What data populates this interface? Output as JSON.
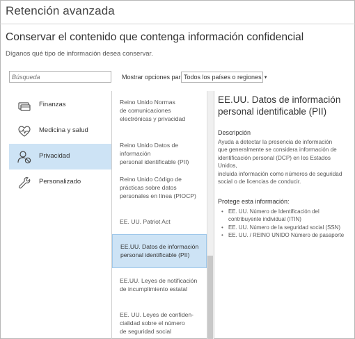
{
  "window": {
    "title": "Retención avanzada"
  },
  "page": {
    "heading": "Conservar el contenido que contenga información confidencial",
    "subheading": "Díganos qué tipo de información desea conservar."
  },
  "search": {
    "placeholder": "Búsqueda"
  },
  "filter": {
    "label": "Mostrar opciones para",
    "selected": "Todos los países o regiones"
  },
  "categories": [
    {
      "label": "Finanzas",
      "icon": "card-icon",
      "selected": false
    },
    {
      "label": "Medicina y salud",
      "icon": "heart-pulse-icon",
      "selected": false
    },
    {
      "label": "Privacidad",
      "icon": "user-block-icon",
      "selected": true
    },
    {
      "label": "Personalizado",
      "icon": "wrench-icon",
      "selected": false
    }
  ],
  "templates": [
    {
      "lines": [
        "Reino Unido Normas",
        "de comunicaciones",
        "electrónicas y privacidad"
      ],
      "selected": false
    },
    {
      "lines": [
        "Reino Unido Datos de información",
        "personal identificable (PII)"
      ],
      "selected": false
    },
    {
      "lines": [
        "Reino Unido Código de",
        "prácticas sobre datos",
        "personales en línea (PIOCP)"
      ],
      "selected": false
    },
    {
      "lines": [
        "EE. UU. Patriot Act"
      ],
      "selected": false
    },
    {
      "lines": [
        "EE.UU. Datos de información",
        "personal identificable (PII)"
      ],
      "selected": true
    },
    {
      "lines": [
        "EE.UU. Leyes de notificación",
        "de incumplimiento estatal"
      ],
      "selected": false
    },
    {
      "lines": [
        "EE. UU. Leyes de confiden-",
        "cialidad sobre el número",
        "de seguridad social"
      ],
      "selected": false
    }
  ],
  "detail": {
    "title_lines": [
      "EE.UU. Datos de información",
      "personal identificable (PII)"
    ],
    "description_heading": "Descripción",
    "description_lines": [
      "Ayuda a detectar la presencia de información",
      "que generalmente se considera información de",
      "identificación personal (DCP) en los Estados Unidos,",
      "incluida información como números de seguridad",
      "social o de licencias de conducir."
    ],
    "protects_heading": "Protege esta información:",
    "protects": [
      {
        "lines": [
          "EE. UU. Número de Identificación del",
          "contribuyente individual (ITIN)"
        ]
      },
      {
        "lines": [
          "EE. UU. Número de la seguridad social (SSN)"
        ]
      },
      {
        "lines": [
          "EE. UU. / REINO UNIDO Número de pasaporte"
        ]
      }
    ]
  },
  "colors": {
    "selected_bg": "#cde3f5",
    "selected_border": "#9fc8ea",
    "text": "#333333",
    "muted": "#555555"
  }
}
